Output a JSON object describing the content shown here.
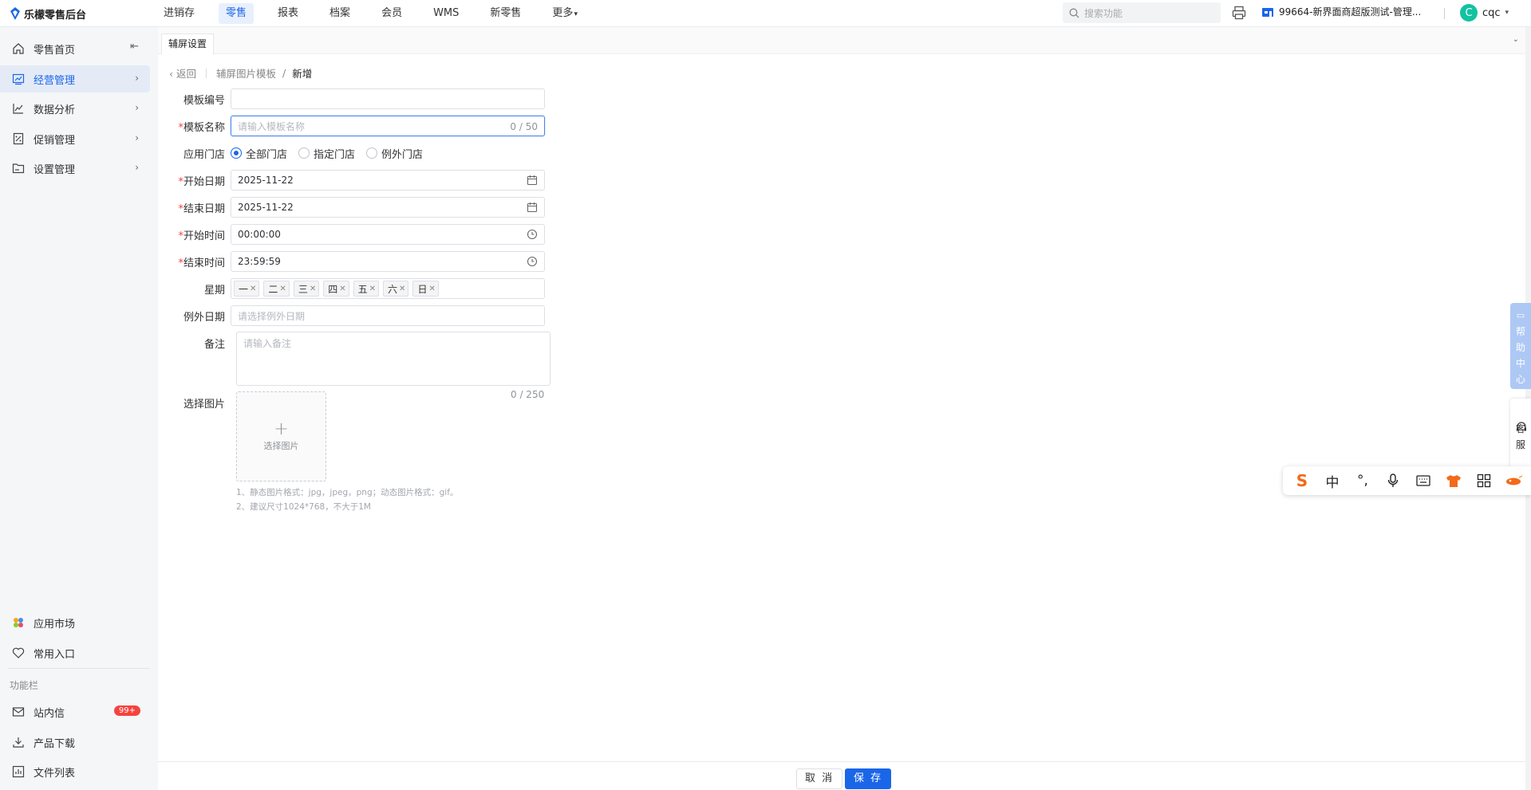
{
  "app": {
    "logo_text": "乐檬零售后台"
  },
  "topnav": [
    {
      "label": "进销存",
      "active": false
    },
    {
      "label": "零售",
      "active": true
    },
    {
      "label": "报表",
      "active": false
    },
    {
      "label": "档案",
      "active": false
    },
    {
      "label": "会员",
      "active": false
    },
    {
      "label": "WMS",
      "active": false
    },
    {
      "label": "新零售",
      "active": false
    },
    {
      "label": "更多",
      "active": false
    }
  ],
  "search": {
    "placeholder": "搜索功能"
  },
  "org": {
    "name": "99664-新界面商超版测试-管理..."
  },
  "user": {
    "avatar_letter": "C",
    "name": "cqc"
  },
  "sidebar": {
    "items": [
      {
        "label": "零售首页",
        "icon": "home-icon"
      },
      {
        "label": "经营管理",
        "icon": "chart-board-icon"
      },
      {
        "label": "数据分析",
        "icon": "line-chart-icon"
      },
      {
        "label": "促销管理",
        "icon": "promotion-icon"
      },
      {
        "label": "设置管理",
        "icon": "folder-icon"
      }
    ],
    "bottom": {
      "app_market": "应用市场",
      "favorites": "常用入口",
      "group_label": "功能栏",
      "messages": "站内信",
      "messages_badge": "99+",
      "downloads": "产品下载",
      "files": "文件列表"
    }
  },
  "tab": {
    "label": "辅屏设置"
  },
  "breadcrumb": {
    "back": "返回",
    "parent": "辅屏图片模板",
    "separator": "/",
    "current": "新增"
  },
  "form": {
    "template_no": {
      "label": "模板编号",
      "value": ""
    },
    "template_name": {
      "label": "模板名称",
      "placeholder": "请输入模板名称",
      "count": "0 / 50"
    },
    "stores": {
      "label": "应用门店",
      "options": [
        "全部门店",
        "指定门店",
        "例外门店"
      ],
      "selected": "全部门店"
    },
    "start_date": {
      "label": "开始日期",
      "value": "2025-11-22"
    },
    "end_date": {
      "label": "结束日期",
      "value": "2025-11-22"
    },
    "start_time": {
      "label": "开始时间",
      "value": "00:00:00"
    },
    "end_time": {
      "label": "结束时间",
      "value": "23:59:59"
    },
    "weekdays": {
      "label": "星期",
      "tags": [
        "一",
        "二",
        "三",
        "四",
        "五",
        "六",
        "日"
      ]
    },
    "except_dates": {
      "label": "例外日期",
      "placeholder": "请选择例外日期"
    },
    "remark": {
      "label": "备注",
      "placeholder": "请输入备注",
      "count": "0 / 250"
    },
    "image": {
      "label": "选择图片",
      "button": "选择图片"
    },
    "hints": [
      "1、静态图片格式：jpg，jpeg，png；动态图片格式：gif。",
      "2、建议尺寸1024*768，不大于1M"
    ]
  },
  "float": {
    "help": [
      "帮",
      "助",
      "中",
      "心"
    ],
    "service": [
      "客",
      "服"
    ]
  },
  "ime": {
    "chinese": "中",
    "punct": "°,"
  },
  "footer": {
    "cancel": "取 消",
    "save": "保 存"
  },
  "colors": {
    "primary": "#1a66e8",
    "required": "#f5433e",
    "badge": "#f5433e",
    "avatar": "#13c2a0"
  }
}
